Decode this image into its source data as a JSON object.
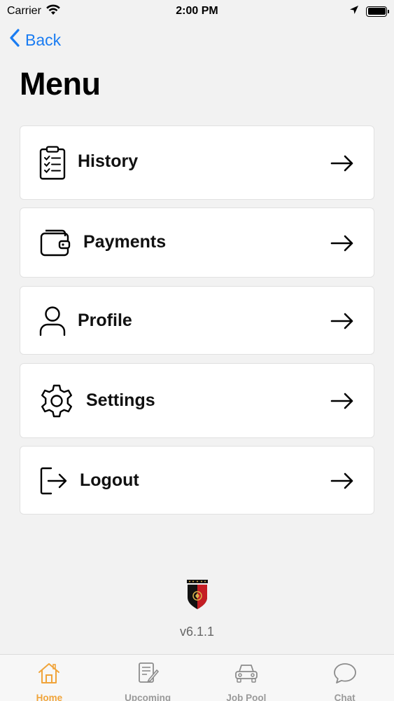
{
  "status_bar": {
    "carrier": "Carrier",
    "time": "2:00 PM"
  },
  "nav": {
    "back_label": "Back"
  },
  "page": {
    "title": "Menu"
  },
  "menu": {
    "items": [
      {
        "label": "History",
        "icon": "clipboard-checklist-icon"
      },
      {
        "label": "Payments",
        "icon": "wallet-icon"
      },
      {
        "label": "Profile",
        "icon": "person-icon"
      },
      {
        "label": "Settings",
        "icon": "gear-icon"
      },
      {
        "label": "Logout",
        "icon": "logout-icon"
      }
    ]
  },
  "footer": {
    "version": "v6.1.1",
    "logo_icon": "shield-logo-icon"
  },
  "tab_bar": {
    "active_color": "#f0a43a",
    "inactive_color": "#9a9a9a",
    "tabs": [
      {
        "label": "Home",
        "icon": "house-icon",
        "active": true
      },
      {
        "label": "Upcoming",
        "icon": "document-pencil-icon",
        "active": false
      },
      {
        "label": "Job Pool",
        "icon": "car-icon",
        "active": false
      },
      {
        "label": "Chat",
        "icon": "chat-bubble-icon",
        "active": false
      }
    ]
  },
  "colors": {
    "accent_blue": "#1a7cf2",
    "background": "#f2f2f2"
  }
}
